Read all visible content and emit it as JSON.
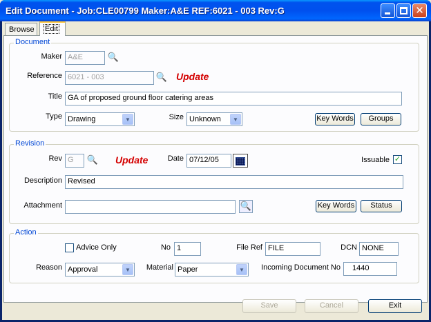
{
  "window": {
    "title": "Edit Document - Job:CLE00799 Maker:A&E REF:6021 - 003 Rev:G"
  },
  "tabs": [
    {
      "label": "Browse"
    },
    {
      "label": "Edit"
    }
  ],
  "document": {
    "group_title": "Document",
    "maker_label": "Maker",
    "maker_value": "A&E",
    "reference_label": "Reference",
    "reference_value": "6021 - 003",
    "update_label": "Update",
    "title_label": "Title",
    "title_value": "GA of proposed ground floor catering areas",
    "type_label": "Type",
    "type_value": "Drawing",
    "size_label": "Size",
    "size_value": "Unknown",
    "keywords_button": "Key Words",
    "groups_button": "Groups"
  },
  "revision": {
    "group_title": "Revision",
    "rev_label": "Rev",
    "rev_value": "G",
    "update_label": "Update",
    "date_label": "Date",
    "date_value": "07/12/05",
    "issuable_label": "Issuable",
    "issuable_checked": true,
    "description_label": "Description",
    "description_value": "Revised",
    "attachment_label": "Attachment",
    "attachment_value": "",
    "keywords_button": "Key Words",
    "status_button": "Status"
  },
  "action": {
    "group_title": "Action",
    "advice_only_label": "Advice Only",
    "advice_only_checked": false,
    "no_label": "No",
    "no_value": "1",
    "fileref_label": "File Ref",
    "fileref_value": "FILE",
    "dcn_label": "DCN",
    "dcn_value": "NONE",
    "reason_label": "Reason",
    "reason_value": "Approval",
    "material_label": "Material",
    "material_value": "Paper",
    "incoming_label": "Incoming Document No",
    "incoming_value": "1440"
  },
  "footer": {
    "save_button": "Save",
    "cancel_button": "Cancel",
    "exit_button": "Exit"
  },
  "icons": {
    "search": "magnifier-icon",
    "calendar": "calendar-icon",
    "dropdown": "chevron-down-icon"
  }
}
